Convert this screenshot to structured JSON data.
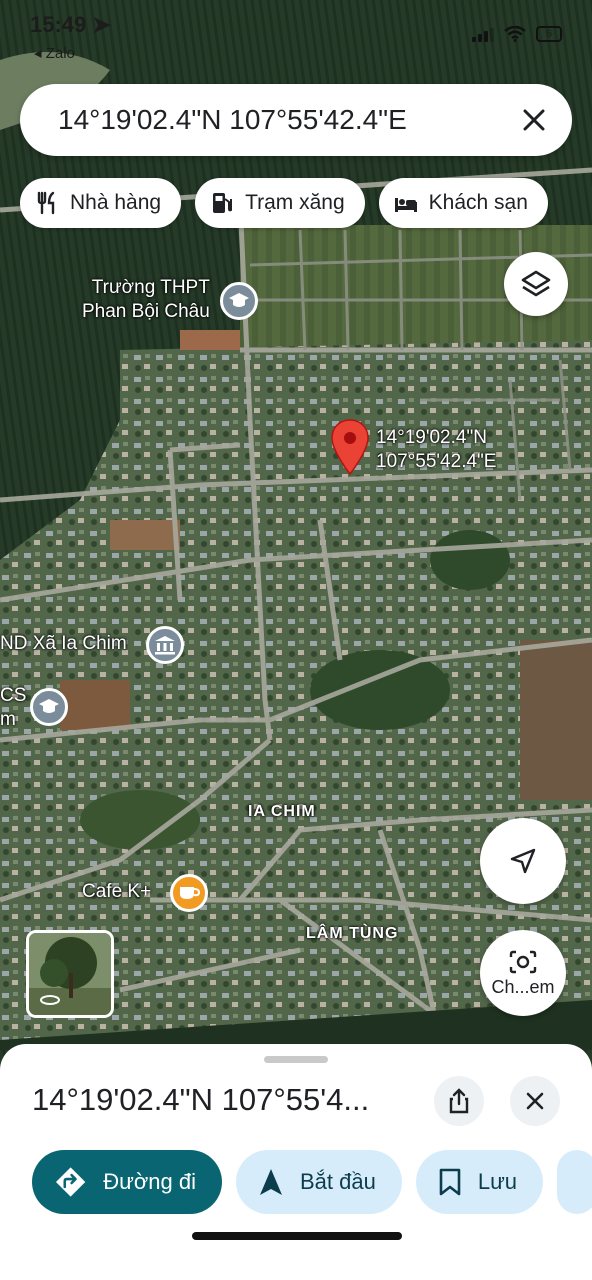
{
  "status": {
    "time": "15:49",
    "back_app": "◂ Zalo",
    "battery": "6"
  },
  "search": {
    "value": "14°19'02.4\"N 107°55'42.4\"E"
  },
  "chips": [
    {
      "label": "Nhà hàng",
      "icon": "restaurant-icon"
    },
    {
      "label": "Trạm xăng",
      "icon": "gas-station-icon"
    },
    {
      "label": "Khách sạn",
      "icon": "hotel-icon"
    }
  ],
  "map": {
    "labels": {
      "school1_line1": "Trường THPT",
      "school1_line2": "Phan Bội Châu",
      "pin_line1": "14°19'02.4\"N",
      "pin_line2": "107°55'42.4\"E",
      "ubnd": "ND Xã Ia Chim",
      "school2_line1": "CS",
      "school2_line2": "m",
      "ia_chim": "IA CHIM",
      "cafe": "Cafe K+",
      "lam_tung": "LÂM TÙNG"
    },
    "colors": {
      "pin": "#ea4335",
      "poi_gray": "#7b8d9a",
      "poi_orange": "#f29b22"
    }
  },
  "camera_button": {
    "label": "Ch...em"
  },
  "sheet": {
    "title": "14°19'02.4\"N 107°55'4...",
    "actions": [
      {
        "label": "Đường đi",
        "icon": "directions-icon"
      },
      {
        "label": "Bắt đầu",
        "icon": "navigation-arrow-icon"
      },
      {
        "label": "Lưu",
        "icon": "bookmark-icon"
      }
    ],
    "accent": "#0a6573"
  }
}
